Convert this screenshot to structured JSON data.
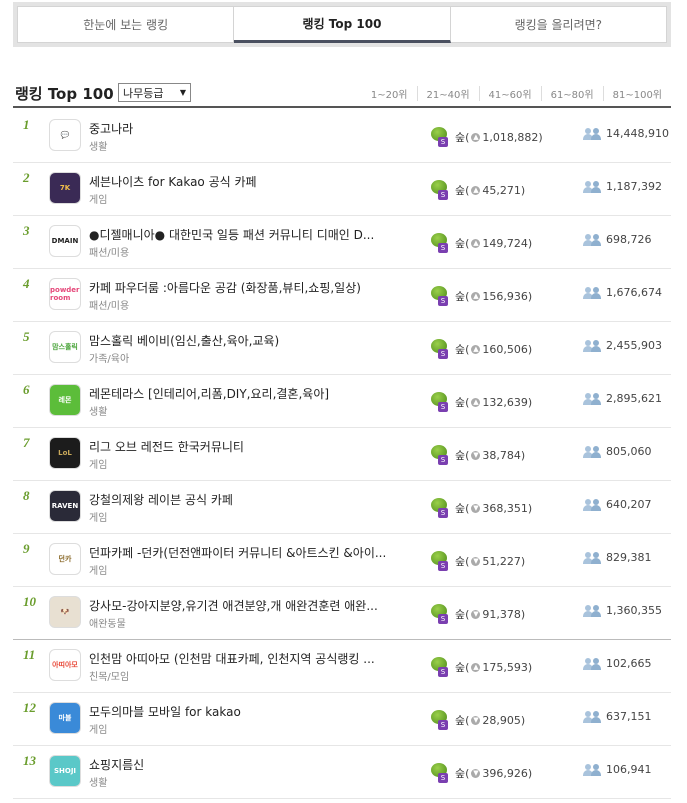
{
  "tabs": [
    "한눈에 보는 랭킹",
    "랭킹 Top 100",
    "랭킹을 올리려면?"
  ],
  "header": {
    "title": "랭킹 Top 100",
    "select_value": "나무등급",
    "ranges": [
      "1~20위",
      "21~40위",
      "41~60위",
      "61~80위",
      "81~100위"
    ]
  },
  "rows": [
    {
      "rank": "1",
      "title": "중고나라",
      "category": "생활",
      "grade": "숲",
      "direction": "up",
      "change": "1,018,882",
      "members": "14,448,910",
      "thumb_color": "#ffffff",
      "thumb_fg": "#f26b3a",
      "thumb_text": "💬"
    },
    {
      "rank": "2",
      "title": "세븐나이츠 for Kakao 공식 카페",
      "category": "게임",
      "grade": "숲",
      "direction": "up",
      "change": "45,271",
      "members": "1,187,392",
      "thumb_color": "#3a2a55",
      "thumb_fg": "#f3c04a",
      "thumb_text": "7K"
    },
    {
      "rank": "3",
      "title": "●디젤매니아● 대한민국 일등 패션 커뮤니티 디매인 D...",
      "category": "패션/미용",
      "grade": "숲",
      "direction": "up",
      "change": "149,724",
      "members": "698,726",
      "thumb_color": "#ffffff",
      "thumb_fg": "#222222",
      "thumb_text": "DMAIN"
    },
    {
      "rank": "4",
      "title": "카페 파우더룸 :아름다운 공감 (화장품,뷰티,쇼핑,일상)",
      "category": "패션/미용",
      "grade": "숲",
      "direction": "up",
      "change": "156,936",
      "members": "1,676,674",
      "thumb_color": "#ffffff",
      "thumb_fg": "#e5487a",
      "thumb_text": "powder room"
    },
    {
      "rank": "5",
      "title": "맘스홀릭 베이비(임신,출산,육아,교육)",
      "category": "가족/육아",
      "grade": "숲",
      "direction": "up",
      "change": "160,506",
      "members": "2,455,903",
      "thumb_color": "#ffffff",
      "thumb_fg": "#4aa43a",
      "thumb_text": "맘스홀릭"
    },
    {
      "rank": "6",
      "title": "레몬테라스 [인테리어,리폼,DIY,요리,결혼,육아]",
      "category": "생활",
      "grade": "숲",
      "direction": "up",
      "change": "132,639",
      "members": "2,895,621",
      "thumb_color": "#5cbd3a",
      "thumb_fg": "#ffffff",
      "thumb_text": "레몬"
    },
    {
      "rank": "7",
      "title": "리그 오브 레전드 한국커뮤니티",
      "category": "게임",
      "grade": "숲",
      "direction": "down",
      "change": "38,784",
      "members": "805,060",
      "thumb_color": "#1c1c1c",
      "thumb_fg": "#c8a85a",
      "thumb_text": "LoL"
    },
    {
      "rank": "8",
      "title": "강철의제왕 레이븐 공식 카페",
      "category": "게임",
      "grade": "숲",
      "direction": "down",
      "change": "368,351",
      "members": "640,207",
      "thumb_color": "#2a2a38",
      "thumb_fg": "#ffffff",
      "thumb_text": "RAVEN"
    },
    {
      "rank": "9",
      "title": "던파카페 -던카(던전앤파이터 커뮤니티 &아트스킨 &아이...",
      "category": "게임",
      "grade": "숲",
      "direction": "down",
      "change": "51,227",
      "members": "829,381",
      "thumb_color": "#ffffff",
      "thumb_fg": "#8a6a2a",
      "thumb_text": "던카"
    },
    {
      "rank": "10",
      "title": "강사모-강아지분양,유기견 애견분양,개 애완견훈련 애완...",
      "category": "애완동물",
      "grade": "숲",
      "direction": "down",
      "change": "91,378",
      "members": "1,360,355",
      "thumb_color": "#e8e0d2",
      "thumb_fg": "#333333",
      "thumb_text": "🐶"
    },
    {
      "rank": "11",
      "title": "인천맘 아띠아모 (인천맘 대표카페, 인천지역 공식랭킹 ...",
      "category": "친목/모임",
      "grade": "숲",
      "direction": "up",
      "change": "175,593",
      "members": "102,665",
      "thumb_color": "#ffffff",
      "thumb_fg": "#e84a3a",
      "thumb_text": "아띠아모"
    },
    {
      "rank": "12",
      "title": "모두의마블 모바일 for kakao",
      "category": "게임",
      "grade": "숲",
      "direction": "down",
      "change": "28,905",
      "members": "637,151",
      "thumb_color": "#3a8ad8",
      "thumb_fg": "#ffffff",
      "thumb_text": "마블"
    },
    {
      "rank": "13",
      "title": "쇼핑지름신",
      "category": "생활",
      "grade": "숲",
      "direction": "down",
      "change": "396,926",
      "members": "106,941",
      "thumb_color": "#5ac8c8",
      "thumb_fg": "#ffffff",
      "thumb_text": "SHOJI"
    }
  ],
  "icons": {
    "grade_icon": "tree-icon",
    "members_icon": "people-icon",
    "up": "▲",
    "down": "▼"
  }
}
